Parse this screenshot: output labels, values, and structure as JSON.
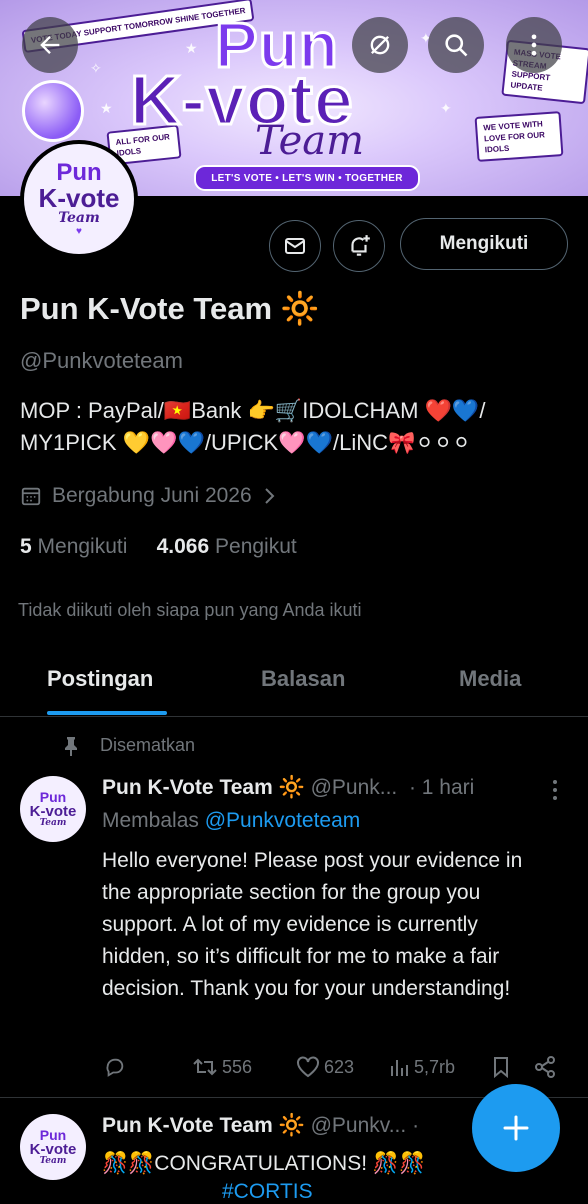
{
  "banner": {
    "title_line1": "Pun",
    "title_line2": "K-vote",
    "title_line3": "Team",
    "sign_left": "VOTE TODAY SUPPORT TOMORROW SHINE TOGETHER",
    "sign_right": "MASS VOTE STREAM SUPPORT UPDATE",
    "sign_love": "WE VOTE WITH LOVE FOR OUR IDOLS",
    "sign_idols": "ALL FOR OUR IDOLS",
    "ribbon": "LET'S VOTE • LET'S WIN • TOGETHER"
  },
  "avatar": {
    "line1": "Pun",
    "line2": "K-vote",
    "line3": "Team",
    "heart": "♥"
  },
  "profile": {
    "follow_label": "Mengikuti",
    "name": "Pun K-Vote Team 🔆",
    "handle": "@Punkvoteteam",
    "bio": "MOP : PayPal/🇻🇳Bank 👉🛒IDOLCHAM ❤️💙/ MY1PICK 💛🩷💙/UPICK🩷💙/LiNC🎀⚪⚪⚪",
    "joined": "Bergabung Juni 2026",
    "following_count": "5",
    "following_label": "Mengikuti",
    "followers_count": "4.066",
    "followers_label": "Pengikut",
    "not_followed": "Tidak diikuti oleh siapa pun yang Anda ikuti"
  },
  "tabs": [
    {
      "label": "Postingan"
    },
    {
      "label": "Balasan"
    },
    {
      "label": "Media"
    }
  ],
  "post1": {
    "pinned_label": "Disematkan",
    "name": "Pun K-Vote Team 🔆",
    "handle": "@Punk...",
    "time": "· 1 hari",
    "replying_prefix": "Membalas",
    "replying_to": "@Punkvoteteam",
    "text": "Hello everyone! Please post your evidence in the appropriate section for the group you support. A lot of my evidence is currently hidden, so it’s difficult for me to make a fair decision. Thank you for your understanding!",
    "reposts": "556",
    "likes": "623",
    "views": "5,7rb"
  },
  "post2": {
    "name": "Pun K-Vote Team 🔆",
    "handle": "@Punkv...",
    "time": "·",
    "text": "🎊🎊CONGRATULATIONS! 🎊🎊",
    "hashtag": "#CORTIS"
  },
  "colors": {
    "accent": "#1d9bf0",
    "background": "#000000",
    "muted": "#71767b",
    "text": "#e7e9ea"
  },
  "icons": {
    "back": "arrow-left-icon",
    "hidden": "eye-slash-icon",
    "search": "search-icon",
    "more": "more-vertical-icon",
    "message": "envelope-icon",
    "notify": "bell-plus-icon",
    "calendar": "calendar-icon",
    "pin": "pin-icon",
    "reply": "reply-icon",
    "repost": "repost-icon",
    "like": "heart-icon",
    "views": "views-icon",
    "bookmark": "bookmark-icon",
    "share": "share-icon",
    "compose": "plus-icon"
  }
}
